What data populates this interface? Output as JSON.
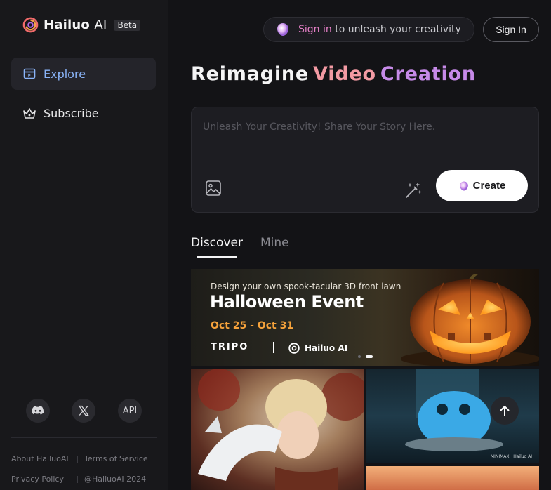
{
  "brand": {
    "name": "Hailuo",
    "name_suffix": "AI",
    "badge": "Beta"
  },
  "sidebar": {
    "items": [
      {
        "label": "Explore",
        "icon": "explore-icon",
        "active": true
      },
      {
        "label": "Subscribe",
        "icon": "crown-icon",
        "active": false
      }
    ],
    "social": [
      {
        "name": "discord-icon"
      },
      {
        "name": "x-icon"
      },
      {
        "label": "API"
      }
    ],
    "footer_links": [
      "About HailuoAI",
      "Terms of Service",
      "Privacy Policy",
      "@HailuoAI 2024"
    ]
  },
  "header": {
    "signin_banner": {
      "highlight": "Sign in",
      "rest": " to unleash your creativity"
    },
    "signin_button": "Sign In"
  },
  "headline": {
    "part1": "Reimagine",
    "part2": "Video",
    "part3": "Creation"
  },
  "prompt": {
    "placeholder": "Unleash Your Creativity! Share Your Story Here.",
    "value": "",
    "create_label": "Create"
  },
  "tabs": [
    {
      "label": "Discover",
      "active": true
    },
    {
      "label": "Mine",
      "active": false
    }
  ],
  "banner": {
    "subtitle": "Design your own spook-tacular 3D front lawn",
    "title": "Halloween Event",
    "dates": "Oct 25 - Oct 31",
    "partner": "TRIPO",
    "host": "Hailuo AI",
    "slide_count": 2,
    "active_slide": 2
  },
  "gallery": {
    "card2_tag": "MINIMAX · Hailuo AI"
  },
  "colors": {
    "accent_blue": "#8ab4f8",
    "accent_pink": "#e47fc6",
    "headline_video": "#f39aa3",
    "headline_creation": "#c68ae8",
    "banner_dates": "#f6a23b"
  }
}
